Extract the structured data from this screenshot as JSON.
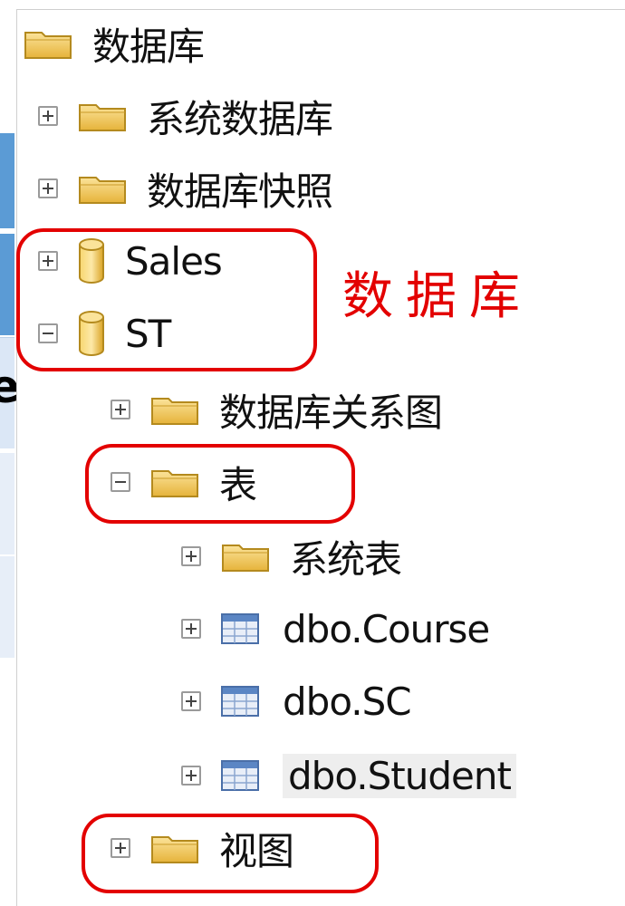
{
  "tree": {
    "root_label": "数据库",
    "items": [
      {
        "label": "系统数据库",
        "type": "folder",
        "expander": "plus"
      },
      {
        "label": "数据库快照",
        "type": "folder",
        "expander": "plus"
      },
      {
        "label": "Sales",
        "type": "database",
        "expander": "plus"
      },
      {
        "label": "ST",
        "type": "database",
        "expander": "minus"
      },
      {
        "label": "数据库关系图",
        "type": "folder",
        "expander": "plus"
      },
      {
        "label": "表",
        "type": "folder",
        "expander": "minus"
      },
      {
        "label": "系统表",
        "type": "folder",
        "expander": "plus"
      },
      {
        "label": "dbo.Course",
        "type": "table",
        "expander": "plus"
      },
      {
        "label": "dbo.SC",
        "type": "table",
        "expander": "plus"
      },
      {
        "label": "dbo.Student",
        "type": "table",
        "expander": "plus",
        "selected": true
      },
      {
        "label": "视图",
        "type": "folder",
        "expander": "plus"
      }
    ]
  },
  "annotation": {
    "label": "数据库",
    "color": "#e30000"
  },
  "left_panel": {
    "partial_char": "e"
  },
  "colors": {
    "accent_blue": "#5b9bd5",
    "annotation_red": "#e30000",
    "folder_yellow": "#f2c94c"
  }
}
